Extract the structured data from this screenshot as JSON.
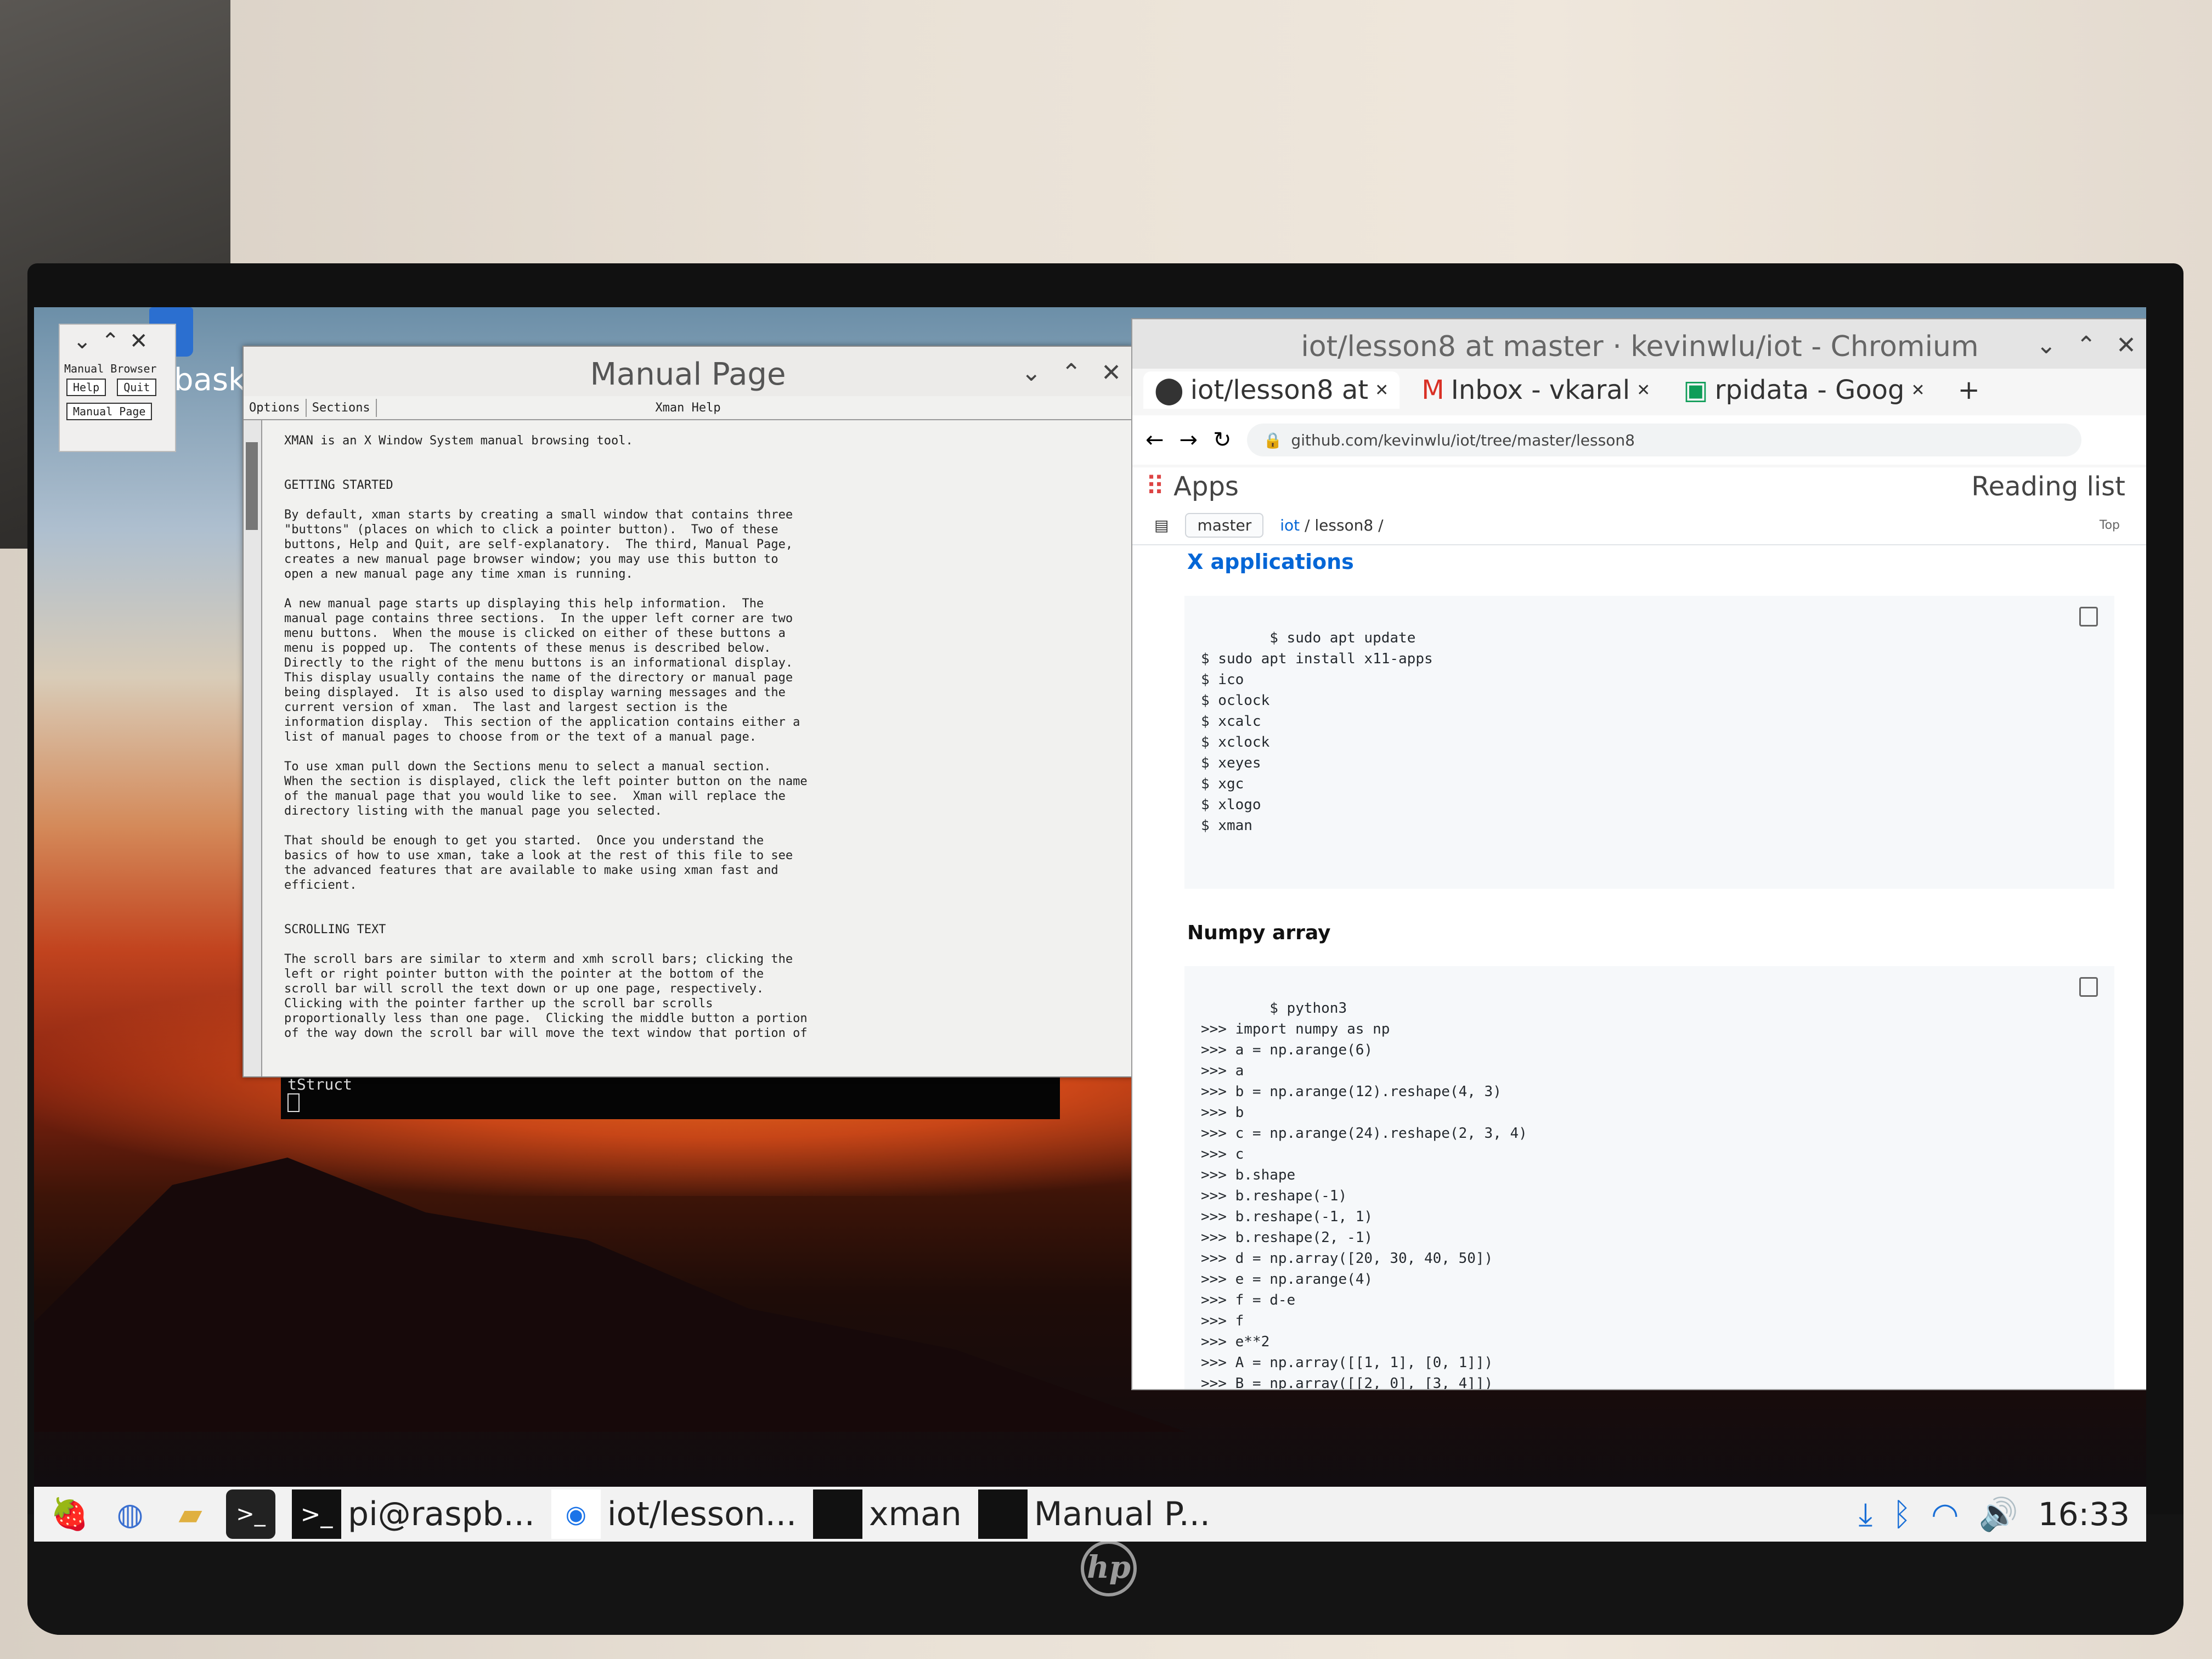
{
  "desktop": {
    "label": "bask"
  },
  "xman_small": {
    "title": "Manual Browser",
    "help_label": "Help",
    "quit_label": "Quit",
    "manual_page_label": "Manual Page"
  },
  "manual_page": {
    "title": "Manual Page",
    "menu_options": "Options",
    "menu_sections": "Sections",
    "info": "Xman Help",
    "text": "XMAN is an X Window System manual browsing tool.\n\n\nGETTING STARTED\n\nBy default, xman starts by creating a small window that contains three\n\"buttons\" (places on which to click a pointer button).  Two of these\nbuttons, Help and Quit, are self-explanatory.  The third, Manual Page,\ncreates a new manual page browser window; you may use this button to\nopen a new manual page any time xman is running.\n\nA new manual page starts up displaying this help information.  The\nmanual page contains three sections.  In the upper left corner are two\nmenu buttons.  When the mouse is clicked on either of these buttons a\nmenu is popped up.  The contents of these menus is described below.\nDirectly to the right of the menu buttons is an informational display.\nThis display usually contains the name of the directory or manual page\nbeing displayed.  It is also used to display warning messages and the\ncurrent version of xman.  The last and largest section is the\ninformation display.  This section of the application contains either a\nlist of manual pages to choose from or the text of a manual page.\n\nTo use xman pull down the Sections menu to select a manual section.\nWhen the section is displayed, click the left pointer button on the name\nof the manual page that you would like to see.  Xman will replace the\ndirectory listing with the manual page you selected.\n\nThat should be enough to get you started.  Once you understand the\nbasics of how to use xman, take a look at the rest of this file to see\nthe advanced features that are available to make using xman fast and\nefficient.\n\n\nSCROLLING TEXT\n\nThe scroll bars are similar to xterm and xmh scroll bars; clicking the\nleft or right pointer button with the pointer at the bottom of the\nscroll bar will scroll the text down or up one page, respectively.\nClicking with the pointer farther up the scroll bar scrolls\nproportionally less than one page.  Clicking the middle button a portion\nof the way down the scroll bar will move the text window that portion of"
  },
  "terminal": {
    "line": "tStruct"
  },
  "chromium": {
    "window_title": "iot/lesson8 at master · kevinwlu/iot - Chromium",
    "tabs": [
      {
        "label": "iot/lesson8 at"
      },
      {
        "label": "Inbox - vkaral"
      },
      {
        "label": "rpidata - Goog"
      }
    ],
    "url": "github.com/kevinwlu/iot/tree/master/lesson8",
    "bookmarks_apps": "Apps",
    "reading_list": "Reading list",
    "branch": "master",
    "crumb_repo": "iot",
    "crumb_path": "/ lesson8 /",
    "top_link": "Top",
    "heading_x": "X applications",
    "code_x": "$ sudo apt update\n$ sudo apt install x11-apps\n$ ico\n$ oclock\n$ xcalc\n$ xclock\n$ xeyes\n$ xgc\n$ xlogo\n$ xman",
    "heading_numpy": "Numpy array",
    "code_numpy": "$ python3\n>>> import numpy as np\n>>> a = np.arange(6)\n>>> a\n>>> b = np.arange(12).reshape(4, 3)\n>>> b\n>>> c = np.arange(24).reshape(2, 3, 4)\n>>> c\n>>> b.shape\n>>> b.reshape(-1)\n>>> b.reshape(-1, 1)\n>>> b.reshape(2, -1)\n>>> d = np.array([20, 30, 40, 50])\n>>> e = np.arange(4)\n>>> f = d-e\n>>> f\n>>> e**2\n>>> A = np.array([[1, 1], [0, 1]])\n>>> B = np.array([[2, 0], [3, 4]])\n>>> A*B\n>>> A.dot(B)"
  },
  "taskbar": {
    "items": [
      {
        "label": "pi@raspb..."
      },
      {
        "label": "iot/lesson..."
      },
      {
        "label": "xman"
      },
      {
        "label": "Manual P..."
      }
    ],
    "clock": "16:33"
  },
  "monitor": {
    "brand": "hp"
  }
}
